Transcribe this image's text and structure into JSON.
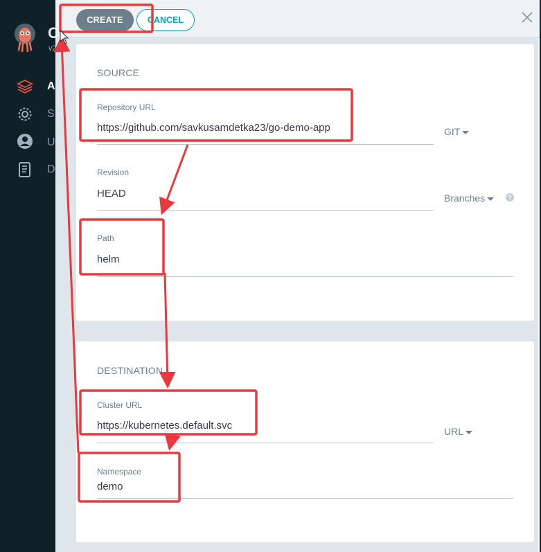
{
  "sidebar": {
    "brand_letter": "C",
    "version": "v2",
    "items": [
      {
        "label": "A",
        "icon": "layers-icon"
      },
      {
        "label": "S",
        "icon": "gear-icon"
      },
      {
        "label": "U",
        "icon": "user-icon"
      },
      {
        "label": "D",
        "icon": "docs-icon"
      }
    ]
  },
  "toolbar": {
    "create_label": "CREATE",
    "cancel_label": "CANCEL",
    "close_icon": "close-icon"
  },
  "source": {
    "title": "SOURCE",
    "repo_url_label": "Repository URL",
    "repo_url_value": "https://github.com/savkusamdetka23/go-demo-app",
    "repo_type": "GIT",
    "revision_label": "Revision",
    "revision_value": "HEAD",
    "revision_type": "Branches",
    "path_label": "Path",
    "path_value": "helm"
  },
  "destination": {
    "title": "DESTINATION",
    "cluster_url_label": "Cluster URL",
    "cluster_url_value": "https://kubernetes.default.svc",
    "cluster_type": "URL",
    "namespace_label": "Namespace",
    "namespace_value": "demo"
  },
  "colors": {
    "annotation": "#e8393f",
    "accent": "#00a2b3",
    "sidebar_bg": "#0f2029"
  }
}
